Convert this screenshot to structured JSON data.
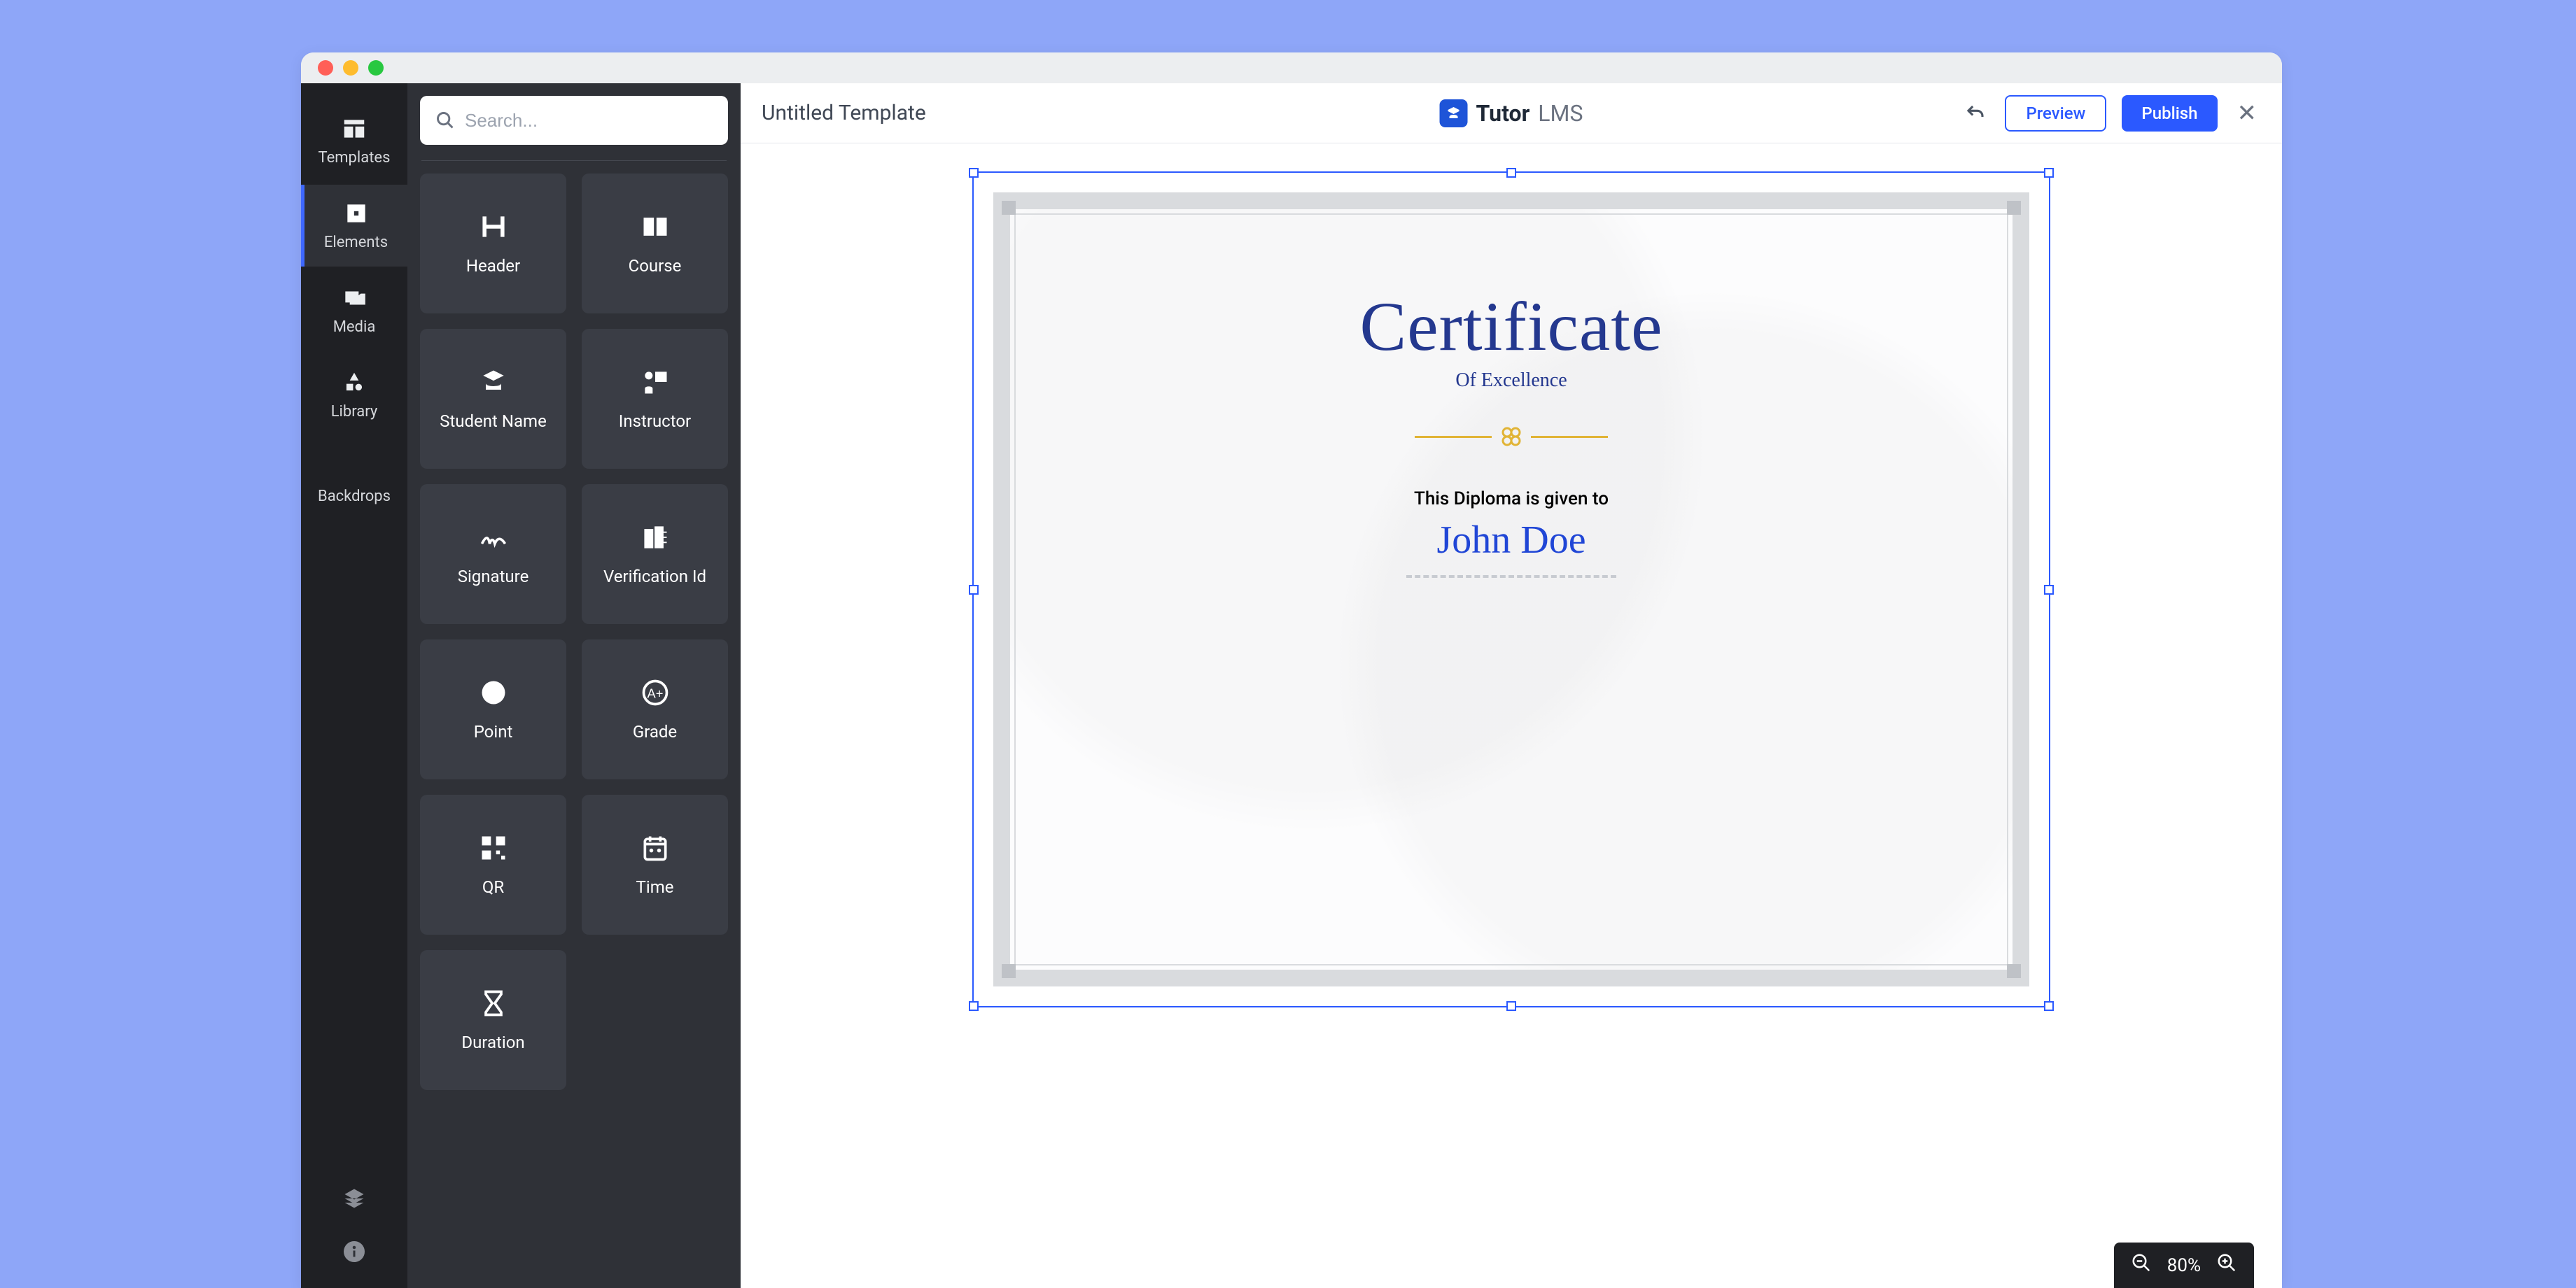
{
  "rail": {
    "templates": "Templates",
    "elements": "Elements",
    "media": "Media",
    "library": "Library",
    "backdrops": "Backdrops"
  },
  "search": {
    "placeholder": "Search..."
  },
  "elements": [
    {
      "label": "Header",
      "icon": "header-icon"
    },
    {
      "label": "Course",
      "icon": "course-icon"
    },
    {
      "label": "Student Name",
      "icon": "student-icon"
    },
    {
      "label": "Instructor",
      "icon": "instructor-icon"
    },
    {
      "label": "Signature",
      "icon": "signature-icon"
    },
    {
      "label": "Verification Id",
      "icon": "verification-icon"
    },
    {
      "label": "Point",
      "icon": "point-icon"
    },
    {
      "label": "Grade",
      "icon": "grade-icon"
    },
    {
      "label": "QR",
      "icon": "qr-icon"
    },
    {
      "label": "Time",
      "icon": "time-icon"
    },
    {
      "label": "Duration",
      "icon": "duration-icon"
    }
  ],
  "topbar": {
    "title": "Untitled Template",
    "brand1": "Tutor",
    "brand2": "LMS",
    "preview": "Preview",
    "publish": "Publish"
  },
  "certificate": {
    "title": "Certificate",
    "subtitle": "Of Excellence",
    "line": "This Diploma is given to",
    "recipient": "John Doe"
  },
  "zoom": {
    "value": "80%"
  }
}
